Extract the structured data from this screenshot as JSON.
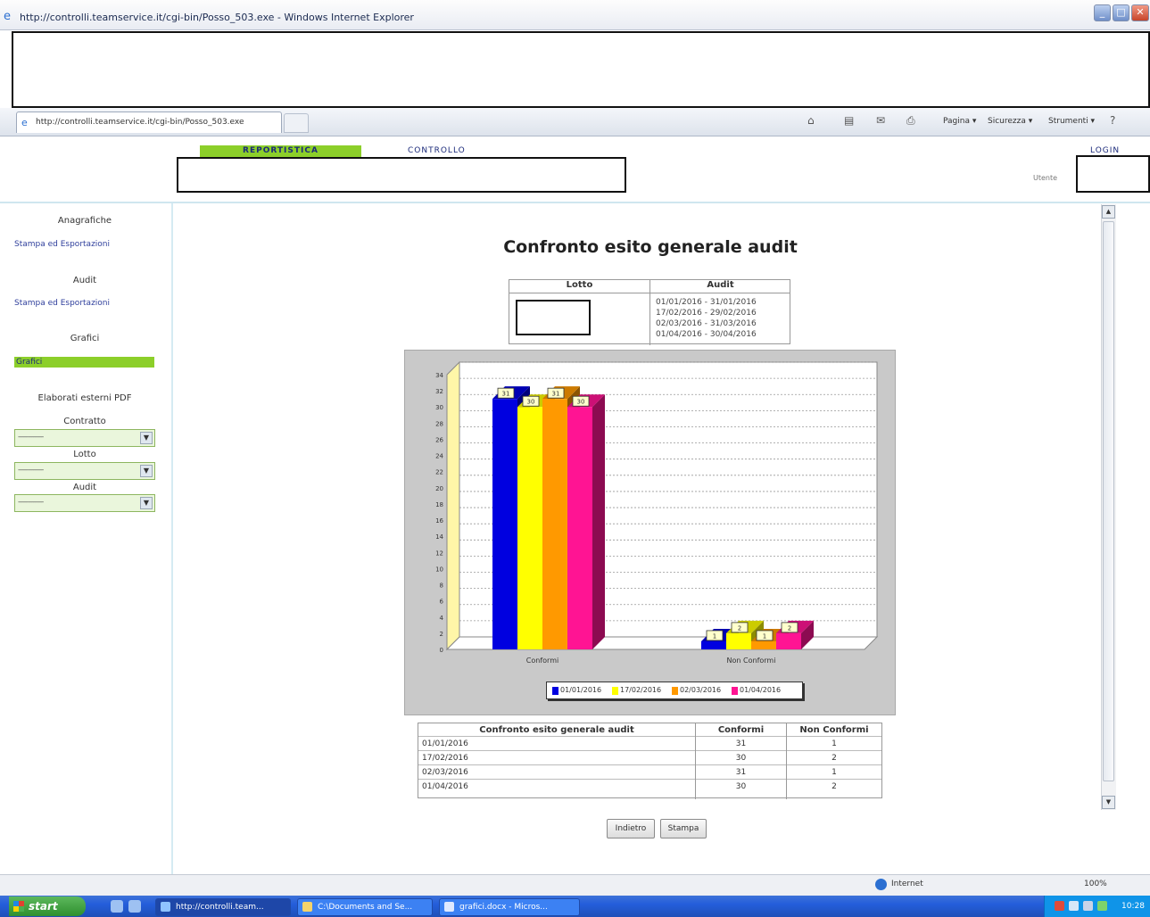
{
  "window": {
    "title": "http://controlli.teamservice.it/cgi-bin/Posso_503.exe - Windows Internet Explorer"
  },
  "tabbar": {
    "tab_label": "http://controlli.teamservice.it/cgi-bin/Posso_503.exe",
    "commands": [
      "Pagina ▾",
      "Sicurezza ▾",
      "Strumenti ▾"
    ]
  },
  "header": {
    "nav_reportistica": "REPORTISTICA",
    "nav_controllo": "CONTROLLO",
    "nav_login": "LOGIN",
    "utente_label": "Utente"
  },
  "sidebar": {
    "anagrafiche_head": "Anagrafiche",
    "anagrafiche_link": "Stampa ed Esportazioni",
    "audit_head": "Audit",
    "audit_link": "Stampa ed Esportazioni",
    "grafici_head": "Grafici",
    "grafici_active": "Grafici",
    "pdf_head": "Elaborati esterni PDF",
    "contratto_label": "Contratto",
    "contratto_value": "---------------",
    "lotto_label": "Lotto",
    "lotto_value": "---------------",
    "audit_label": "Audit",
    "audit_value": "---------------"
  },
  "content": {
    "title": "Confronto esito generale audit",
    "lotto_header": "Lotto",
    "audit_header": "Audit",
    "audit_periods": [
      "01/01/2016 - 31/01/2016",
      "17/02/2016 - 29/02/2016",
      "02/03/2016 - 31/03/2016",
      "01/04/2016 - 30/04/2016"
    ]
  },
  "chart_data": {
    "type": "bar",
    "title": "",
    "categories": [
      "Conformi",
      "Non Conformi"
    ],
    "series": [
      {
        "name": "01/01/2016",
        "color": "#0000e0",
        "values": [
          31,
          1
        ]
      },
      {
        "name": "17/02/2016",
        "color": "#ffff00",
        "values": [
          30,
          2
        ]
      },
      {
        "name": "02/03/2016",
        "color": "#ff9900",
        "values": [
          31,
          1
        ]
      },
      {
        "name": "01/04/2016",
        "color": "#ff1493",
        "values": [
          30,
          2
        ]
      }
    ],
    "ylim": [
      0,
      34
    ],
    "yticks": [
      0,
      2,
      4,
      6,
      8,
      10,
      12,
      14,
      16,
      18,
      20,
      22,
      24,
      26,
      28,
      30,
      32,
      34
    ],
    "grid": true,
    "legend": "bottom"
  },
  "table": {
    "headers": [
      "Confronto esito generale audit",
      "Conformi",
      "Non Conformi"
    ],
    "rows": [
      [
        "01/01/2016",
        "31",
        "1"
      ],
      [
        "17/02/2016",
        "30",
        "2"
      ],
      [
        "02/03/2016",
        "31",
        "1"
      ],
      [
        "01/04/2016",
        "30",
        "2"
      ]
    ]
  },
  "actions": {
    "indietro": "Indietro",
    "stampa": "Stampa"
  },
  "statusbar": {
    "zone": "Internet",
    "zoom": "100%"
  },
  "taskbar": {
    "start": "start",
    "tasks": [
      "http://controlli.team...",
      "C:\\Documents and Se...",
      "grafici.docx - Micros..."
    ],
    "clock": "10:28"
  }
}
